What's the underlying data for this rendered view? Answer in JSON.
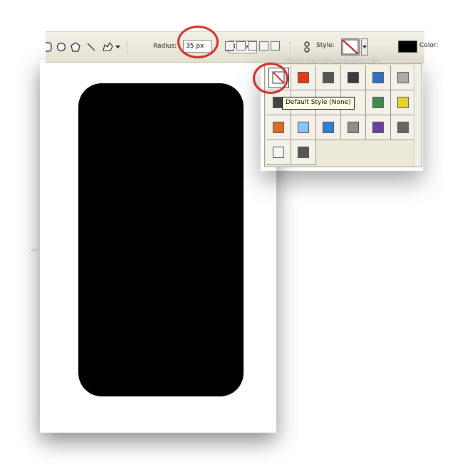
{
  "toolbar": {
    "radius_label": "Radius:",
    "radius_value": "35 px",
    "style_label": "Style:",
    "color_label": "Color:",
    "color_value": "#000000",
    "tool_icons": [
      "rounded-rectangle-tool-icon",
      "ellipse-tool-icon",
      "polygon-tool-icon",
      "line-tool-icon",
      "custom-shape-tool-icon",
      "tool-dropdown-icon"
    ],
    "mode_icons": [
      "new-shape-layer-icon",
      "add-to-area-icon",
      "subtract-area-icon",
      "intersect-area-icon",
      "exclude-area-icon"
    ],
    "link_icon": "chain-link-icon"
  },
  "style_picker": {
    "watermark": "doolbuttenzora.blogspot.com",
    "tooltip": "Default Style (None)",
    "cells": [
      {
        "name": "default-style-none",
        "color": "#ffffff"
      },
      {
        "name": "style-red-glow",
        "color": "#e33a12"
      },
      {
        "name": "style-dark-gray",
        "color": "#555555"
      },
      {
        "name": "style-dark-glossy",
        "color": "#3b3b3b"
      },
      {
        "name": "style-blue-glossy",
        "color": "#2f6fc9"
      },
      {
        "name": "style-light-gray",
        "color": "#aaaaaa"
      },
      {
        "name": "style-dark-slate",
        "color": "#444444"
      },
      {
        "name": "style-hidden-1",
        "color": "#f3f1e8"
      },
      {
        "name": "style-hidden-2",
        "color": "#f3f1e8"
      },
      {
        "name": "style-hidden-3",
        "color": "#f3f1e8"
      },
      {
        "name": "style-rainbow",
        "color": "#3f8c4a"
      },
      {
        "name": "style-yellow-frame",
        "color": "#e8d320"
      },
      {
        "name": "style-orange-sunset",
        "color": "#d86a2a"
      },
      {
        "name": "style-light-blue",
        "color": "#8fc3ee"
      },
      {
        "name": "style-sky-horizon",
        "color": "#2f7fd2"
      },
      {
        "name": "style-gray-photo",
        "color": "#8d8d8d"
      },
      {
        "name": "style-purple",
        "color": "#6b3fa6"
      },
      {
        "name": "style-gray-block",
        "color": "#666666"
      },
      {
        "name": "style-white-outline",
        "color": "#f4f4f4"
      },
      {
        "name": "style-charcoal",
        "color": "#555555"
      }
    ]
  },
  "canvas": {
    "side_text": "doo",
    "shape_color": "#000000"
  },
  "accent": {
    "annotation_red": "#d62b2b"
  }
}
